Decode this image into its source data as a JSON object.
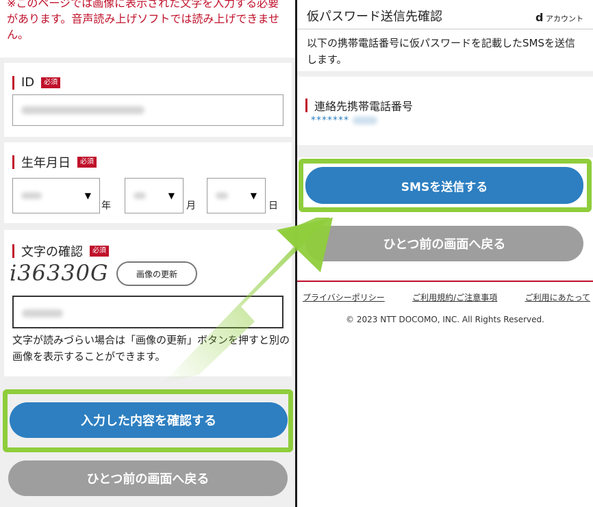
{
  "left": {
    "notice": "※このページでは画像に表示された文字を入力する必要があります。音声読み上げソフトでは読み上げできません。",
    "id_label": "ID",
    "required": "必須",
    "birth_label": "生年月日",
    "year_unit": "年",
    "month_unit": "月",
    "day_unit": "日",
    "captcha_label": "文字の確認",
    "captcha_text": "i36330G",
    "refresh_label": "画像の更新",
    "help_text": "文字が読みづらい場合は「画像の更新」ボタンを押すと別の画像を表示することができます。",
    "confirm_button": "入力した内容を確認する",
    "back_button": "ひとつ前の画面へ戻る"
  },
  "right": {
    "title": "仮パスワード送信先確認",
    "logo_d": "d",
    "logo_text": "アカウント",
    "description": "以下の携帯電話番号に仮パスワードを記載したSMSを送信します。",
    "phone_label": "連絡先携帯電話番号",
    "phone_masked": "*******",
    "send_button": "SMSを送信する",
    "back_button": "ひとつ前の画面へ戻る",
    "footer_links": [
      "プライバシーポリシー",
      "ご利用規約/ご注意事項",
      "ご利用にあたって"
    ],
    "copyright": "© 2023 NTT DOCOMO, INC. All Rights Reserved."
  },
  "colors": {
    "brand_red": "#c0102a",
    "primary_blue": "#2d7fc1",
    "highlight_green": "#8fcd3c",
    "secondary_gray": "#9e9e9e"
  }
}
